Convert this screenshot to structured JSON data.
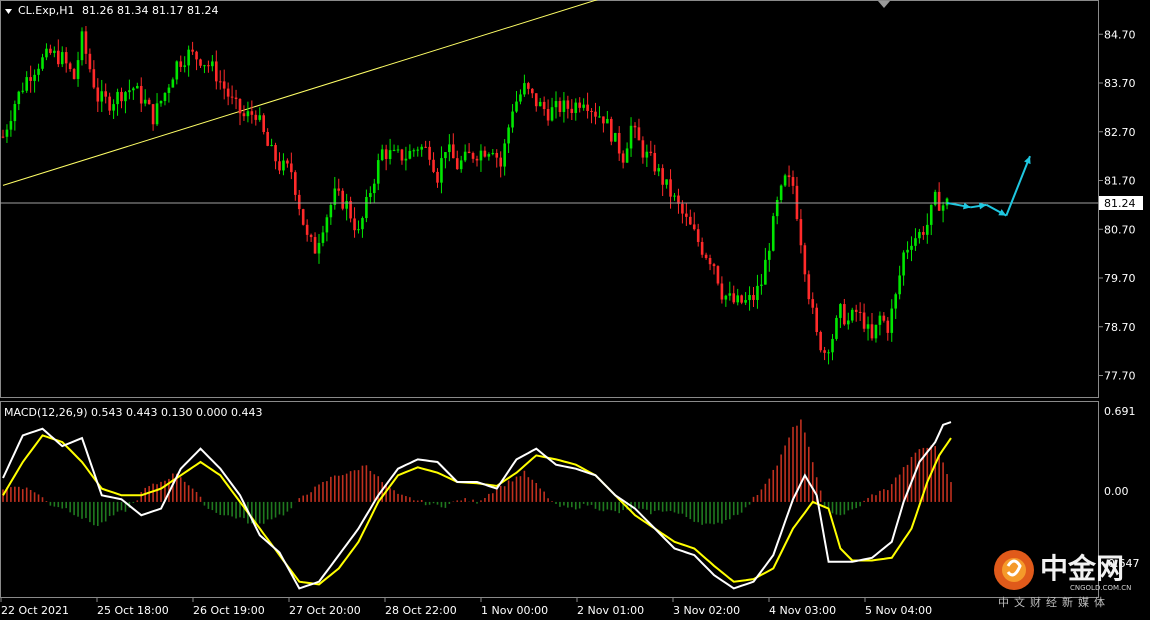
{
  "header": {
    "symbol": "CL.Exp,H1",
    "ohlc": "81.26 81.34 81.17 81.24"
  },
  "current_price_label": "81.24",
  "macd": {
    "label": "MACD(12,26,9) 0.543 0.443 0.130 0.000 0.443",
    "top_label": "0.691",
    "zero_label": "0.00",
    "bottom_label": "-0.647"
  },
  "watermark": {
    "name": "中金网",
    "url": "CNGOLD.COM.CN",
    "subtitle": "中文财经新媒体"
  },
  "colors": {
    "background": "#000000",
    "bull": "#00e600",
    "bear": "#ff2a2a",
    "trendline": "#ffff66",
    "arrows": "#1fc7e0",
    "macd_line": "#ffffff",
    "signal_line": "#ffff00",
    "hist_pos": "#c0301f",
    "hist_neg": "#1f7a1f"
  },
  "chart_data": [
    {
      "type": "candlestick",
      "timeframe": "H1",
      "y_ticks": [
        "84.70",
        "83.70",
        "82.70",
        "81.70",
        "80.70",
        "79.70",
        "78.70",
        "77.70"
      ],
      "ylim": [
        77.3,
        85.3
      ],
      "x_ticks": [
        "22 Oct 2021",
        "25 Oct 18:00",
        "26 Oct 19:00",
        "27 Oct 20:00",
        "28 Oct 22:00",
        "1 Nov 00:00",
        "2 Nov 01:00",
        "3 Nov 02:00",
        "4 Nov 03:00",
        "5 Nov 04:00"
      ],
      "current_price": 81.24,
      "close_path": [
        [
          0,
          82.6
        ],
        [
          3,
          83.3
        ],
        [
          6,
          83.8
        ],
        [
          9,
          84.1
        ],
        [
          12,
          84.3
        ],
        [
          15,
          84.2
        ],
        [
          18,
          83.8
        ],
        [
          20,
          84.6
        ],
        [
          22,
          84.0
        ],
        [
          24,
          83.4
        ],
        [
          27,
          83.3
        ],
        [
          30,
          83.5
        ],
        [
          33,
          83.6
        ],
        [
          36,
          83.3
        ],
        [
          38,
          83.0
        ],
        [
          41,
          83.5
        ],
        [
          44,
          84.1
        ],
        [
          47,
          84.3
        ],
        [
          50,
          84.2
        ],
        [
          53,
          84.0
        ],
        [
          56,
          83.6
        ],
        [
          58,
          83.3
        ],
        [
          61,
          83.0
        ],
        [
          64,
          83.1
        ],
        [
          67,
          82.4
        ],
        [
          70,
          82.0
        ],
        [
          73,
          81.9
        ],
        [
          75,
          81.2
        ],
        [
          77,
          80.5
        ],
        [
          79,
          80.3
        ],
        [
          81,
          80.8
        ],
        [
          84,
          81.4
        ],
        [
          87,
          81.2
        ],
        [
          90,
          80.6
        ],
        [
          93,
          81.5
        ],
        [
          96,
          82.3
        ],
        [
          99,
          82.2
        ],
        [
          102,
          82.2
        ],
        [
          105,
          82.4
        ],
        [
          108,
          82.3
        ],
        [
          110,
          81.8
        ],
        [
          112,
          82.4
        ],
        [
          115,
          82.0
        ],
        [
          118,
          82.2
        ],
        [
          121,
          82.3
        ],
        [
          124,
          82.4
        ],
        [
          126,
          82.0
        ],
        [
          129,
          83.2
        ],
        [
          132,
          83.6
        ],
        [
          135,
          83.3
        ],
        [
          138,
          83.1
        ],
        [
          141,
          83.2
        ],
        [
          144,
          83.2
        ],
        [
          147,
          83.4
        ],
        [
          150,
          83.1
        ],
        [
          152,
          83.0
        ],
        [
          155,
          82.5
        ],
        [
          157,
          82.2
        ],
        [
          159,
          82.8
        ],
        [
          162,
          82.3
        ],
        [
          165,
          82.0
        ],
        [
          167,
          81.7
        ],
        [
          170,
          81.3
        ],
        [
          172,
          81.0
        ],
        [
          175,
          80.6
        ],
        [
          177,
          80.3
        ],
        [
          180,
          80.0
        ],
        [
          182,
          79.4
        ],
        [
          185,
          79.2
        ],
        [
          188,
          79.2
        ],
        [
          190,
          79.3
        ],
        [
          192,
          79.6
        ],
        [
          194,
          80.4
        ],
        [
          196,
          81.2
        ],
        [
          198,
          81.7
        ],
        [
          200,
          81.6
        ],
        [
          202,
          80.5
        ],
        [
          204,
          79.4
        ],
        [
          206,
          78.5
        ],
        [
          208,
          78.2
        ],
        [
          210,
          78.5
        ],
        [
          212,
          79.0
        ],
        [
          214,
          78.8
        ],
        [
          216,
          79.0
        ],
        [
          218,
          78.8
        ],
        [
          220,
          78.4
        ],
        [
          222,
          78.9
        ],
        [
          224,
          78.7
        ],
        [
          226,
          79.3
        ],
        [
          228,
          80.2
        ],
        [
          230,
          80.5
        ],
        [
          232,
          80.6
        ],
        [
          234,
          80.8
        ],
        [
          236,
          81.3
        ],
        [
          238,
          81.2
        ],
        [
          239,
          81.24
        ]
      ],
      "forecast_arrows": [
        {
          "from": [
            239,
            81.24
          ],
          "to": [
            245,
            81.15
          ]
        },
        {
          "from": [
            245,
            81.15
          ],
          "to": [
            249,
            81.2
          ]
        },
        {
          "from": [
            249,
            81.2
          ],
          "to": [
            254,
            80.98
          ]
        },
        {
          "from": [
            254,
            80.98
          ],
          "to": [
            260,
            82.2
          ]
        }
      ],
      "trendline": {
        "from": [
          0,
          81.6
        ],
        "to": [
          158,
          85.6
        ]
      }
    },
    {
      "type": "macd",
      "params": [
        12,
        26,
        9
      ],
      "values": {
        "macd": 0.543,
        "signal": 0.443,
        "histogram": 0.13,
        "level": 0.0,
        "extra": 0.443
      },
      "ylim": [
        -0.647,
        0.691
      ],
      "main_path": [
        [
          0,
          0.18
        ],
        [
          5,
          0.5
        ],
        [
          10,
          0.55
        ],
        [
          15,
          0.42
        ],
        [
          20,
          0.48
        ],
        [
          25,
          0.05
        ],
        [
          30,
          0.02
        ],
        [
          35,
          -0.1
        ],
        [
          40,
          -0.05
        ],
        [
          45,
          0.25
        ],
        [
          50,
          0.4
        ],
        [
          55,
          0.25
        ],
        [
          60,
          0.05
        ],
        [
          65,
          -0.25
        ],
        [
          70,
          -0.38
        ],
        [
          75,
          -0.65
        ],
        [
          80,
          -0.6
        ],
        [
          85,
          -0.4
        ],
        [
          90,
          -0.2
        ],
        [
          95,
          0.05
        ],
        [
          100,
          0.25
        ],
        [
          105,
          0.32
        ],
        [
          110,
          0.3
        ],
        [
          115,
          0.15
        ],
        [
          120,
          0.15
        ],
        [
          125,
          0.1
        ],
        [
          130,
          0.32
        ],
        [
          135,
          0.4
        ],
        [
          140,
          0.28
        ],
        [
          145,
          0.25
        ],
        [
          150,
          0.2
        ],
        [
          155,
          0.05
        ],
        [
          160,
          -0.05
        ],
        [
          165,
          -0.2
        ],
        [
          170,
          -0.35
        ],
        [
          175,
          -0.4
        ],
        [
          180,
          -0.55
        ],
        [
          185,
          -0.65
        ],
        [
          190,
          -0.6
        ],
        [
          195,
          -0.4
        ],
        [
          200,
          0.02
        ],
        [
          203,
          0.2
        ],
        [
          206,
          0.05
        ],
        [
          209,
          -0.45
        ],
        [
          212,
          -0.45
        ],
        [
          215,
          -0.45
        ],
        [
          220,
          -0.42
        ],
        [
          225,
          -0.3
        ],
        [
          228,
          0.0
        ],
        [
          232,
          0.3
        ],
        [
          236,
          0.45
        ],
        [
          238,
          0.58
        ],
        [
          240,
          0.6
        ]
      ],
      "signal_path": [
        [
          0,
          0.05
        ],
        [
          5,
          0.3
        ],
        [
          10,
          0.5
        ],
        [
          15,
          0.45
        ],
        [
          20,
          0.3
        ],
        [
          25,
          0.1
        ],
        [
          30,
          0.05
        ],
        [
          35,
          0.05
        ],
        [
          40,
          0.1
        ],
        [
          45,
          0.2
        ],
        [
          50,
          0.3
        ],
        [
          55,
          0.2
        ],
        [
          60,
          0.0
        ],
        [
          65,
          -0.2
        ],
        [
          70,
          -0.4
        ],
        [
          75,
          -0.6
        ],
        [
          80,
          -0.62
        ],
        [
          85,
          -0.5
        ],
        [
          90,
          -0.3
        ],
        [
          95,
          0.0
        ],
        [
          100,
          0.2
        ],
        [
          105,
          0.26
        ],
        [
          110,
          0.22
        ],
        [
          115,
          0.15
        ],
        [
          120,
          0.14
        ],
        [
          125,
          0.12
        ],
        [
          130,
          0.22
        ],
        [
          135,
          0.35
        ],
        [
          140,
          0.32
        ],
        [
          145,
          0.28
        ],
        [
          150,
          0.2
        ],
        [
          155,
          0.05
        ],
        [
          160,
          -0.1
        ],
        [
          165,
          -0.2
        ],
        [
          170,
          -0.3
        ],
        [
          175,
          -0.35
        ],
        [
          180,
          -0.48
        ],
        [
          185,
          -0.6
        ],
        [
          190,
          -0.58
        ],
        [
          195,
          -0.5
        ],
        [
          200,
          -0.2
        ],
        [
          205,
          0.0
        ],
        [
          209,
          -0.05
        ],
        [
          212,
          -0.35
        ],
        [
          215,
          -0.44
        ],
        [
          220,
          -0.44
        ],
        [
          225,
          -0.42
        ],
        [
          230,
          -0.2
        ],
        [
          234,
          0.15
        ],
        [
          237,
          0.35
        ],
        [
          240,
          0.48
        ]
      ],
      "histogram": [
        [
          0,
          0.1
        ],
        [
          4,
          0.12
        ],
        [
          8,
          0.08
        ],
        [
          12,
          -0.02
        ],
        [
          16,
          -0.05
        ],
        [
          20,
          -0.12
        ],
        [
          24,
          -0.18
        ],
        [
          28,
          -0.1
        ],
        [
          32,
          -0.05
        ],
        [
          36,
          0.1
        ],
        [
          40,
          0.15
        ],
        [
          44,
          0.22
        ],
        [
          48,
          0.1
        ],
        [
          52,
          -0.05
        ],
        [
          56,
          -0.1
        ],
        [
          60,
          -0.12
        ],
        [
          64,
          -0.18
        ],
        [
          68,
          -0.12
        ],
        [
          72,
          -0.08
        ],
        [
          76,
          0.05
        ],
        [
          80,
          0.12
        ],
        [
          84,
          0.2
        ],
        [
          88,
          0.22
        ],
        [
          92,
          0.28
        ],
        [
          96,
          0.15
        ],
        [
          100,
          0.05
        ],
        [
          104,
          0.02
        ],
        [
          108,
          -0.02
        ],
        [
          112,
          -0.03
        ],
        [
          116,
          0.02
        ],
        [
          120,
          0.0
        ],
        [
          124,
          0.08
        ],
        [
          128,
          0.15
        ],
        [
          132,
          0.22
        ],
        [
          136,
          0.1
        ],
        [
          140,
          -0.03
        ],
        [
          144,
          -0.05
        ],
        [
          148,
          -0.02
        ],
        [
          152,
          -0.06
        ],
        [
          156,
          -0.08
        ],
        [
          160,
          -0.05
        ],
        [
          164,
          -0.08
        ],
        [
          168,
          -0.06
        ],
        [
          172,
          -0.1
        ],
        [
          176,
          -0.15
        ],
        [
          180,
          -0.18
        ],
        [
          184,
          -0.12
        ],
        [
          188,
          -0.05
        ],
        [
          192,
          0.1
        ],
        [
          196,
          0.28
        ],
        [
          200,
          0.55
        ],
        [
          202,
          0.62
        ],
        [
          204,
          0.4
        ],
        [
          206,
          0.2
        ],
        [
          208,
          -0.05
        ],
        [
          212,
          -0.1
        ],
        [
          216,
          -0.05
        ],
        [
          220,
          0.05
        ],
        [
          224,
          0.1
        ],
        [
          228,
          0.25
        ],
        [
          232,
          0.4
        ],
        [
          236,
          0.42
        ],
        [
          240,
          0.15
        ]
      ]
    }
  ]
}
